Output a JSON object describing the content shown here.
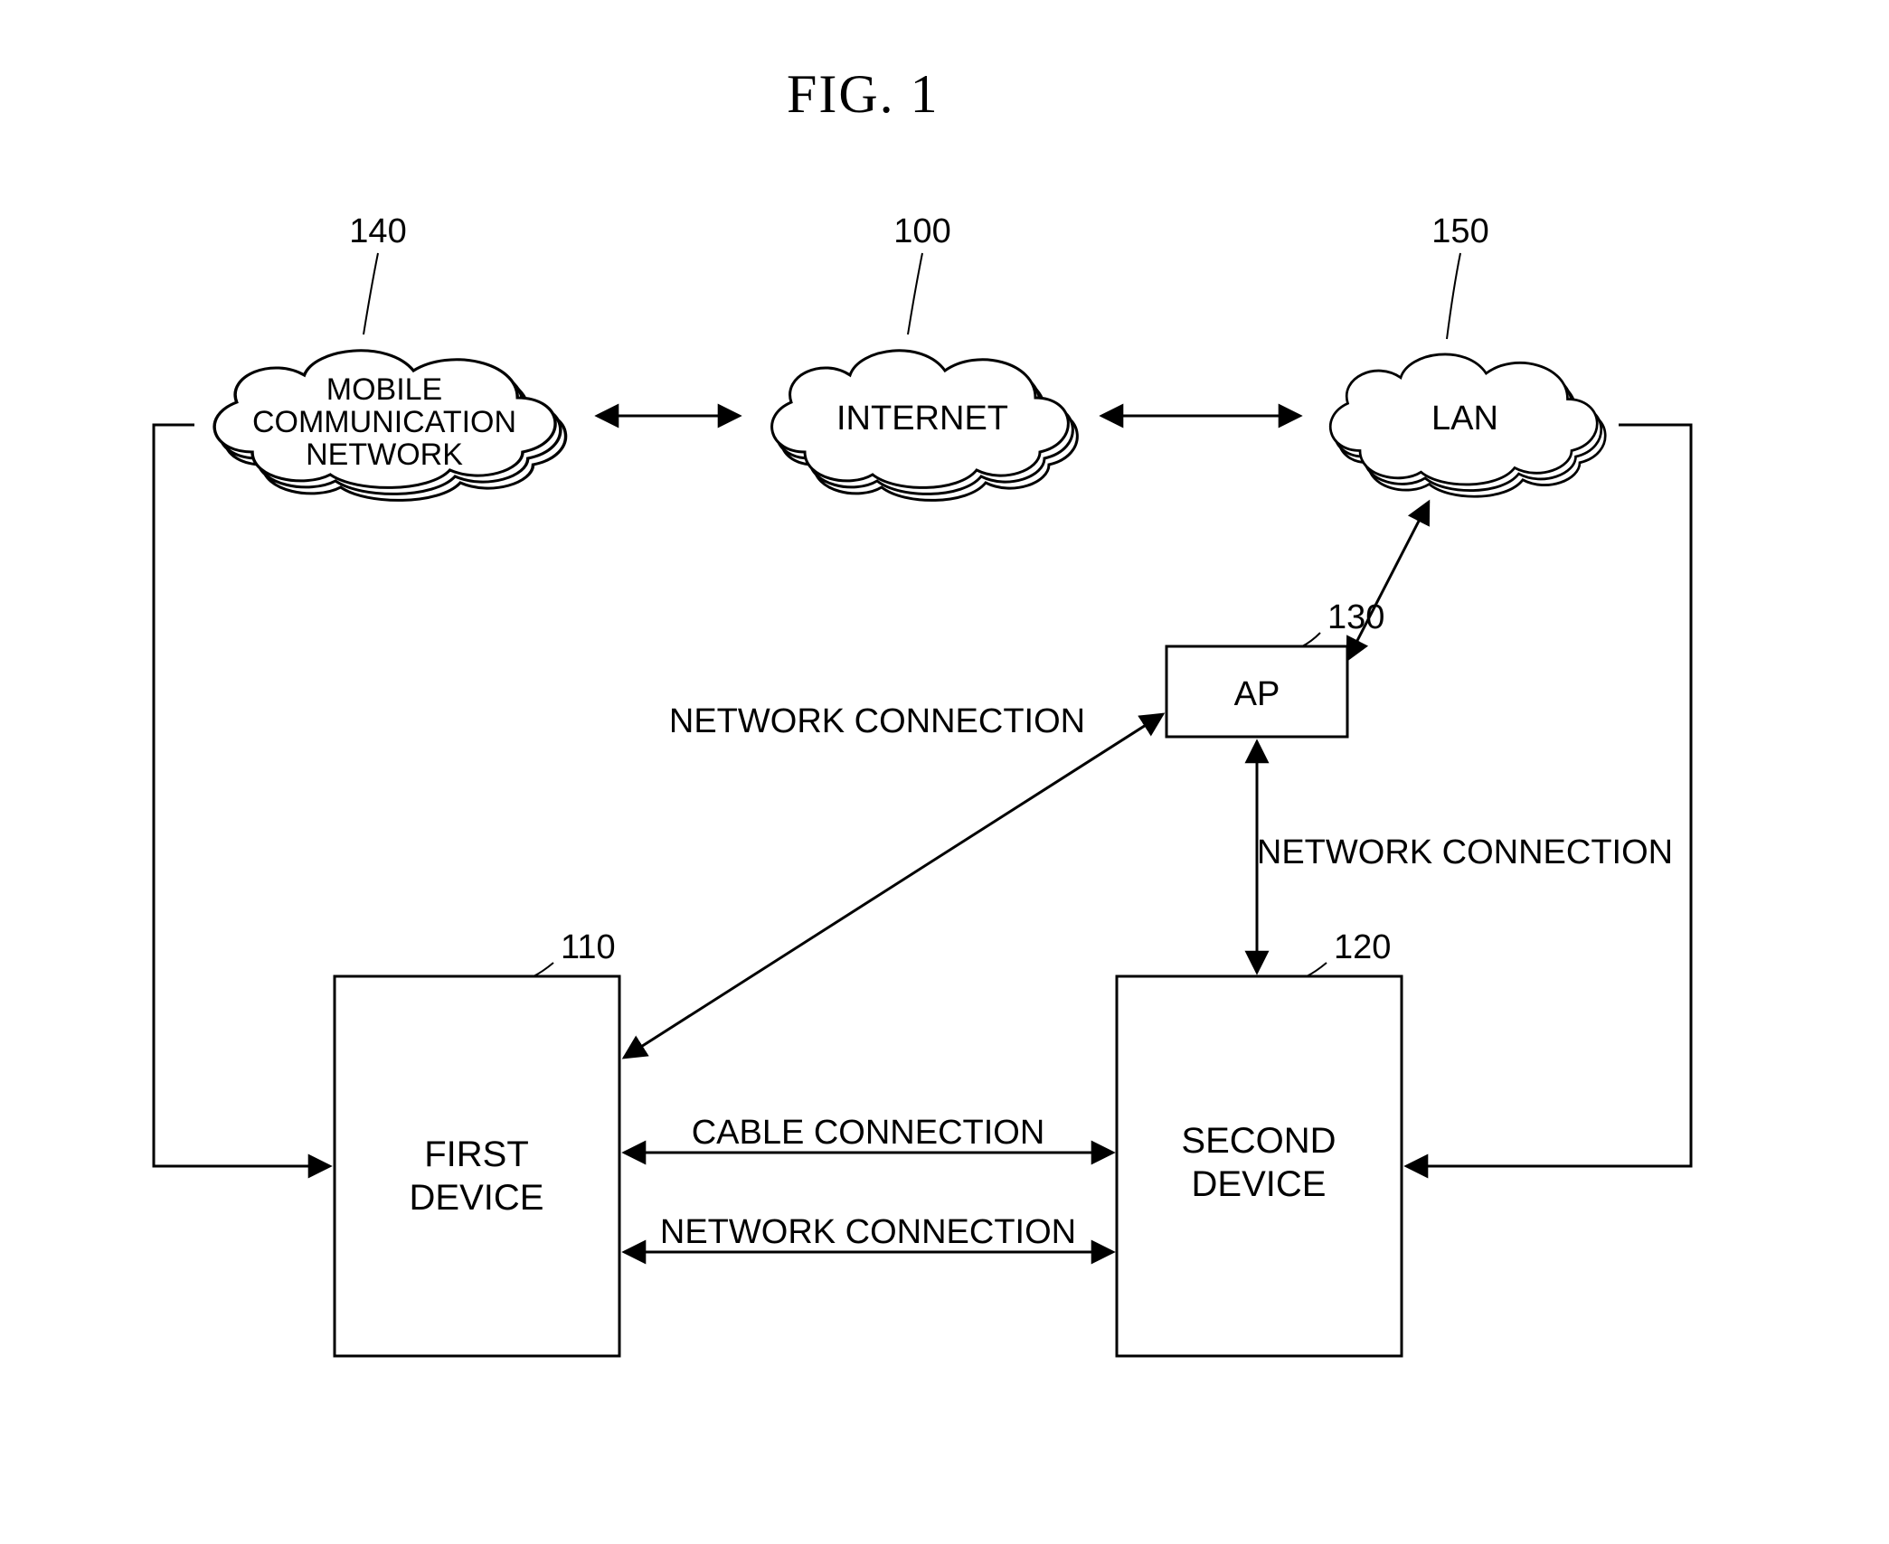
{
  "figure": {
    "title": "FIG.  1",
    "nodes": {
      "mobile_net": {
        "ref": "140",
        "label_lines": [
          "MOBILE",
          "COMMUNICATION",
          "NETWORK"
        ]
      },
      "internet": {
        "ref": "100",
        "label": "INTERNET"
      },
      "lan": {
        "ref": "150",
        "label": "LAN"
      },
      "ap": {
        "ref": "130",
        "label": "AP"
      },
      "first_device": {
        "ref": "110",
        "label_lines": [
          "FIRST",
          "DEVICE"
        ]
      },
      "second_device": {
        "ref": "120",
        "label_lines": [
          "SECOND",
          "DEVICE"
        ]
      }
    },
    "connection_labels": {
      "first_ap": "NETWORK CONNECTION",
      "ap_second": "NETWORK CONNECTION",
      "cable": "CABLE CONNECTION",
      "first_second_net": "NETWORK CONNECTION"
    }
  }
}
